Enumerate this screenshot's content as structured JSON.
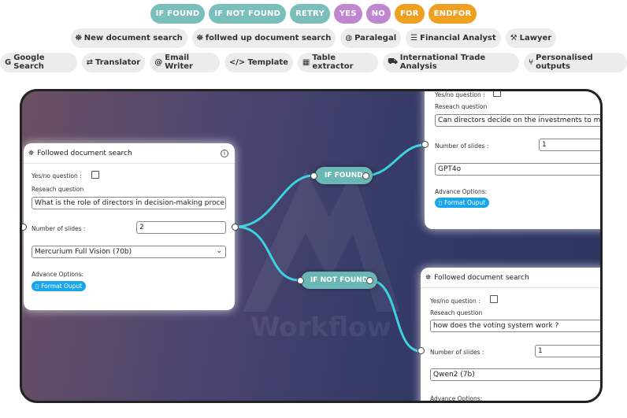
{
  "colors": {
    "teal": "#7bbfbc",
    "purple": "#b287c4",
    "orange": "#f0a020",
    "edge": "#3fd0e0",
    "button_blue": "#19a7ea"
  },
  "flow_keywords": [
    {
      "label": "IF FOUND",
      "color": "#7bbfbc"
    },
    {
      "label": "IF NOT FOUND",
      "color": "#7bbfbc"
    },
    {
      "label": "RETRY",
      "color": "#7bbfbc"
    },
    {
      "label": "YES",
      "color": "#c086cf"
    },
    {
      "label": "NO",
      "color": "#c086cf"
    },
    {
      "label": "FOR",
      "color": "#f0a020"
    },
    {
      "label": "ENDFOR",
      "color": "#f0a020"
    }
  ],
  "toolbar_row2": [
    {
      "icon": "binoculars-icon",
      "glyph": "⛯",
      "label": "New document search"
    },
    {
      "icon": "binoculars-icon",
      "glyph": "⛯",
      "label": "follwed up document search"
    },
    {
      "icon": "paralegal-icon",
      "glyph": "◍",
      "label": "Paralegal"
    },
    {
      "icon": "chart-icon",
      "glyph": "☰",
      "label": "Financial Analyst"
    },
    {
      "icon": "gavel-icon",
      "glyph": "⚒",
      "label": "Lawyer"
    }
  ],
  "toolbar_row3": [
    {
      "icon": "google-icon",
      "glyph": "G",
      "label": "Google Search"
    },
    {
      "icon": "translate-icon",
      "glyph": "⇄",
      "label": "Translator"
    },
    {
      "icon": "at-icon",
      "glyph": "@",
      "label": "Email Writer"
    },
    {
      "icon": "code-icon",
      "glyph": "</>",
      "label": "Template"
    },
    {
      "icon": "table-icon",
      "glyph": "▦",
      "label": "Table extractor"
    },
    {
      "icon": "truck-icon",
      "glyph": "⛟",
      "label": "International Trade Analysis"
    },
    {
      "icon": "branch-icon",
      "glyph": "⑂",
      "label": "Personalised outputs"
    }
  ],
  "watermark": "Workflow",
  "node_left": {
    "title": "Followed document search",
    "yesno_label": "Yes/no question :",
    "question_label": "Reseach question",
    "question_value": "What is the role of directors in decision-making proce",
    "slides_label": "Number of slides :",
    "slides_value": "2",
    "model_value": "Mercurium Full Vision (70b)",
    "advance_label": "Advance Options:",
    "format_button": "Format Ouput"
  },
  "node_top_right": {
    "yesno_label": "Yes/no question :",
    "question_label": "Reseach question",
    "question_value": "Can directors decide on the investments to ma",
    "slides_label": "Number of slides :",
    "slides_value": "1",
    "model_value": "GPT4o",
    "advance_label": "Advance Options:",
    "format_button": "Format Ouput"
  },
  "node_bottom_right": {
    "title": "Followed document search",
    "yesno_label": "Yes/no question :",
    "question_label": "Reseach question",
    "question_value": "how does the voting system work ?",
    "slides_label": "Number of slides :",
    "slides_value": "1",
    "model_value": "Qwen2 (7b)",
    "advance_label": "Advance Options:"
  },
  "conditions": {
    "found": "IF FOUND",
    "not_found": "IF NOT FOUND"
  }
}
